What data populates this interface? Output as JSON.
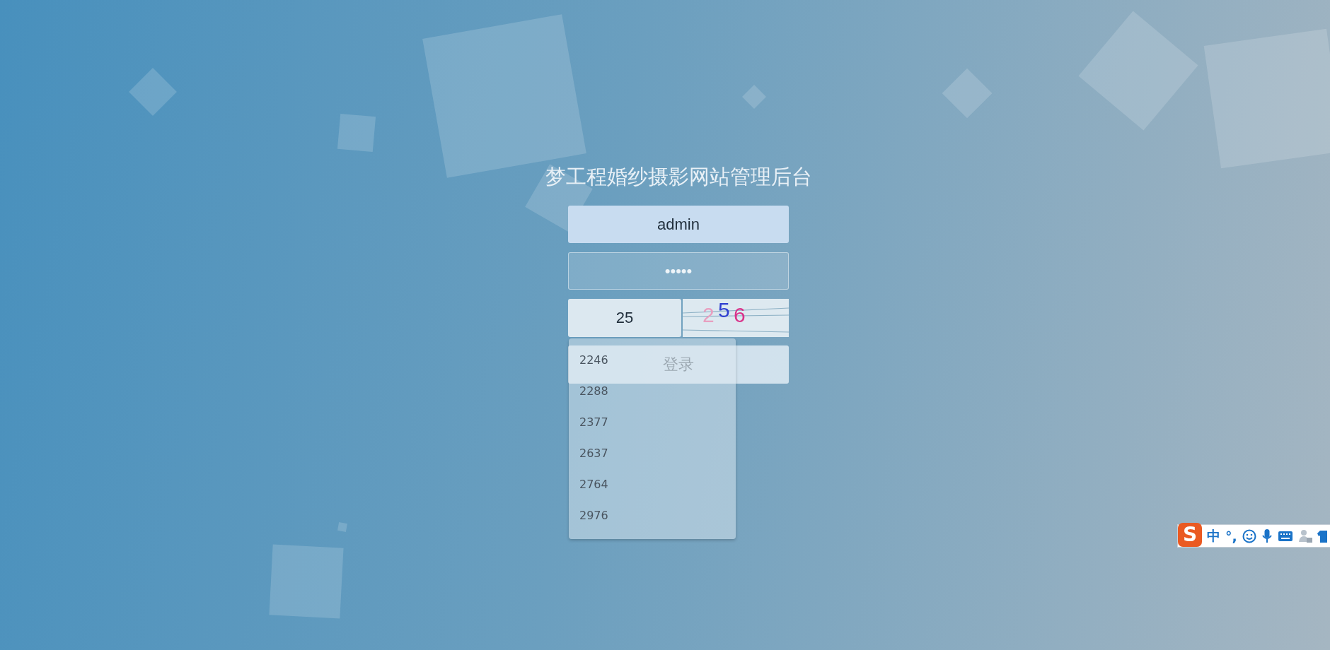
{
  "title": "梦工程婚纱摄影网站管理后台",
  "username": {
    "value": "admin"
  },
  "password": {
    "value": "•••••"
  },
  "captcha": {
    "value": "25",
    "digits": [
      {
        "text": "2",
        "color": "#e8a0c0"
      },
      {
        "text": "5",
        "color": "#2f3fd0"
      },
      {
        "text": "6",
        "color": "#d9338a"
      }
    ]
  },
  "suggestions": [
    "2246",
    "2288",
    "2377",
    "2637",
    "2764",
    "2976"
  ],
  "login_button": "登录",
  "ime_toolbar": {
    "logo": "S",
    "mode": "中",
    "punctuation": "°,"
  }
}
